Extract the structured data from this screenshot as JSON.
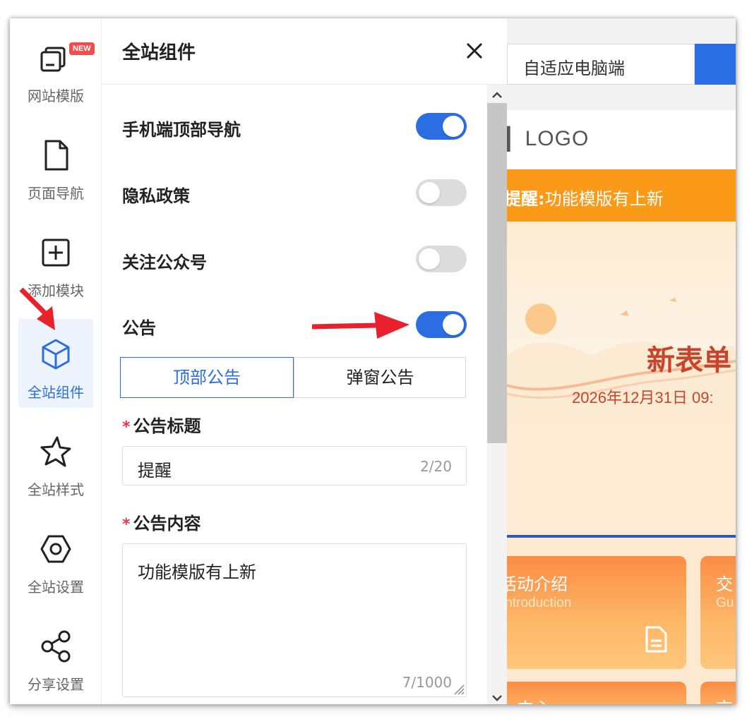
{
  "sidebar": {
    "items": [
      {
        "label": "网站模版",
        "icon": "template-icon",
        "badge": "NEW"
      },
      {
        "label": "页面导航",
        "icon": "page-icon"
      },
      {
        "label": "添加模块",
        "icon": "add-box-icon"
      },
      {
        "label": "全站组件",
        "icon": "cube-icon",
        "active": true
      },
      {
        "label": "全站样式",
        "icon": "star-icon"
      },
      {
        "label": "全站设置",
        "icon": "hex-nut-icon"
      },
      {
        "label": "分享设置",
        "icon": "share-icon"
      }
    ]
  },
  "panel": {
    "title": "全站组件",
    "toggles": [
      {
        "label": "手机端顶部导航",
        "on": true
      },
      {
        "label": "隐私政策",
        "on": false
      },
      {
        "label": "关注公众号",
        "on": false
      },
      {
        "label": "公告",
        "on": true
      }
    ],
    "tabs": [
      {
        "label": "顶部公告",
        "active": true
      },
      {
        "label": "弹窗公告",
        "active": false
      }
    ],
    "title_field": {
      "label": "公告标题",
      "required_mark": "*",
      "value": "提醒",
      "count": "2/20"
    },
    "content_field": {
      "label": "公告内容",
      "required_mark": "*",
      "value": "功能模版有上新",
      "count": "7/1000"
    }
  },
  "preview": {
    "device": "自适应电脑端",
    "logo_text": "LOGO",
    "notice_label": "提醒:",
    "notice_text": "功能模版有上新",
    "banner_title": "新表单",
    "banner_date": "2026年12月31日 09:",
    "cards": [
      {
        "title": "活动介绍",
        "subtitle": "Introduction"
      },
      {
        "title": "交",
        "subtitle": "Gu"
      },
      {
        "title": "中心",
        "subtitle": ""
      },
      {
        "title": "交",
        "subtitle": ""
      }
    ]
  },
  "colors": {
    "accent": "#2b6de2",
    "notice_bar": "#fb9a18",
    "banner_title": "#c8442c",
    "required": "#e8374a",
    "annotation_arrow": "#e8212c"
  }
}
